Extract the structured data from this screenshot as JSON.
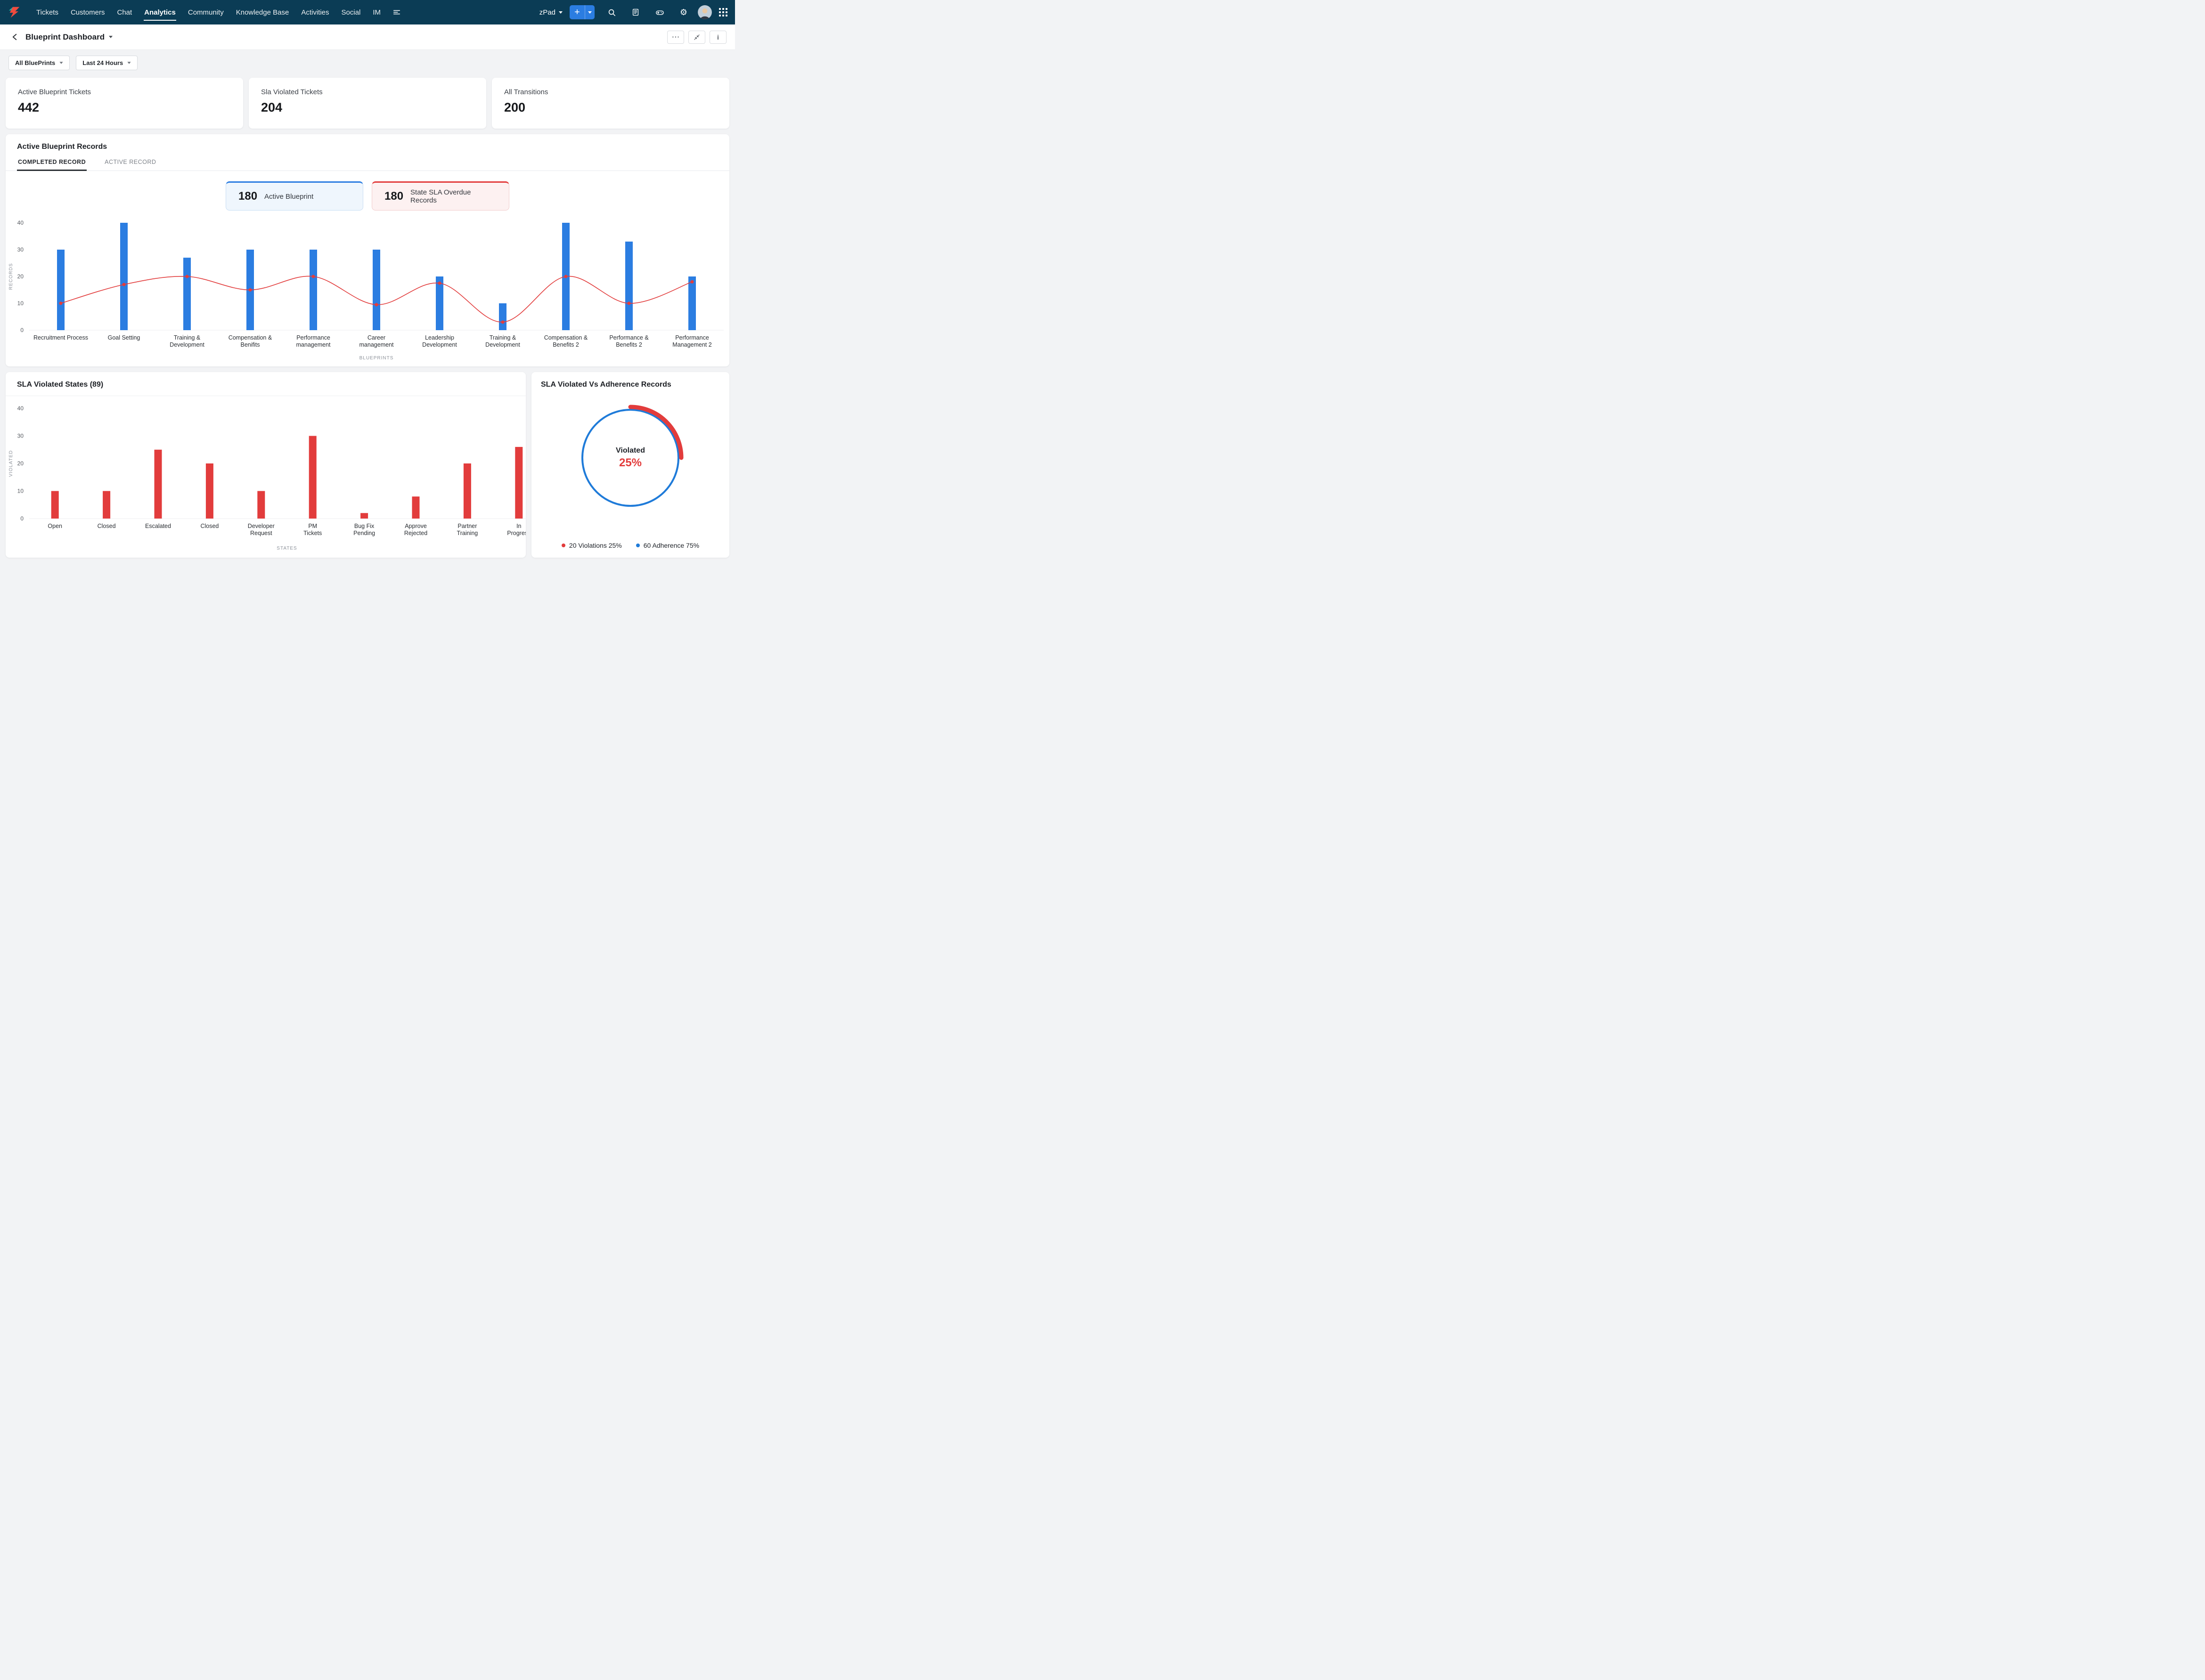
{
  "colors": {
    "navbar_bg": "#0b3c55",
    "accent_blue": "#2b7de1",
    "accent_red": "#e23c3c",
    "donut_blue": "#1f7bd9",
    "page_bg": "#f2f3f5"
  },
  "navbar": {
    "items": [
      "Tickets",
      "Customers",
      "Chat",
      "Analytics",
      "Community",
      "Knowledge Base",
      "Activities",
      "Social",
      "IM"
    ],
    "active_item": "Analytics",
    "workspace": "zPad",
    "add_label": "+",
    "icons": [
      "nav-more-icon",
      "search-icon",
      "reports-icon",
      "games-icon",
      "settings-gear-icon",
      "user-avatar",
      "apps-grid-icon"
    ]
  },
  "header": {
    "title": "Blueprint Dashboard",
    "action_icons": [
      "more-ellipsis-icon",
      "collapse-icon",
      "info-icon"
    ]
  },
  "filters": {
    "blueprint": "All BluePrints",
    "time_range": "Last 24 Hours"
  },
  "kpis": [
    {
      "label": "Active Blueprint Tickets",
      "value": "442"
    },
    {
      "label": "Sla Violated Tickets",
      "value": "204"
    },
    {
      "label": "All Transitions",
      "value": "200"
    }
  ],
  "records_card": {
    "tabs": [
      {
        "label": "COMPLETED RECORD",
        "active": true
      },
      {
        "label": "ACTIVE RECORD",
        "active": false
      }
    ],
    "chips": [
      {
        "value": "180",
        "label": "Active Blueprint",
        "accent": "#2b7de1"
      },
      {
        "value": "180",
        "label": "State SLA Overdue Records",
        "accent": "#e23c3c"
      }
    ]
  },
  "chart_data": [
    {
      "id": "blueprint_records",
      "type": "bar",
      "subtype": "bar-line-combo",
      "title": "Active Blueprint Records",
      "xlabel": "BLUEPRINTS",
      "ylabel": "RECORDS",
      "ylim": [
        0,
        40
      ],
      "yticks": [
        0,
        10,
        20,
        30,
        40
      ],
      "grid": false,
      "categories": [
        [
          "Recruitment Process"
        ],
        [
          "Goal Setting"
        ],
        [
          "Training &",
          "Development"
        ],
        [
          "Compensation &",
          "Benifits"
        ],
        [
          "Performance",
          "management"
        ],
        [
          "Career",
          "management"
        ],
        [
          "Leadership",
          "Development"
        ],
        [
          "Training &",
          "Development"
        ],
        [
          "Compensation &",
          "Benefits 2"
        ],
        [
          "Performance &",
          "Benefits 2"
        ],
        [
          "Performance",
          "Management 2"
        ]
      ],
      "bar_series": {
        "name": "Active Blueprint",
        "color": "#2b7de1",
        "values": [
          30,
          40,
          27,
          30,
          30,
          30,
          20,
          10,
          40,
          33,
          20
        ]
      },
      "line_series": {
        "name": "State SLA Overdue Records",
        "color": "#e23c3c",
        "values": [
          10,
          17,
          20,
          15,
          20,
          9.5,
          17.5,
          3,
          20,
          10,
          18
        ]
      }
    },
    {
      "id": "sla_violated_states",
      "type": "bar",
      "title": "SLA Violated States (89)",
      "xlabel": "STATES",
      "ylabel": "VIOLATED",
      "ylim": [
        0,
        40
      ],
      "yticks": [
        0,
        10,
        20,
        30,
        40
      ],
      "grid": false,
      "categories": [
        [
          "Open"
        ],
        [
          "Closed"
        ],
        [
          "Escalated"
        ],
        [
          "Closed"
        ],
        [
          "Developer",
          "Request"
        ],
        [
          "PM",
          "Tickets"
        ],
        [
          "Bug Fix",
          "Pending"
        ],
        [
          "Approve",
          "Rejected"
        ],
        [
          "Partner",
          "Training"
        ],
        [
          "In",
          "Progress"
        ]
      ],
      "values": [
        10,
        10,
        25,
        20,
        10,
        30,
        2,
        8,
        20,
        26
      ],
      "bar_color": "#e23c3c"
    },
    {
      "id": "sla_violated_vs_adherence",
      "type": "pie",
      "subtype": "donut",
      "title": "SLA Violated Vs Adherence Records",
      "center_label": "Violated",
      "center_value": "25%",
      "legend_position": "bottom",
      "slices": [
        {
          "label": "20 Violations 25%",
          "count": 20,
          "value": 25,
          "color": "#e23c3c"
        },
        {
          "label": "60 Adherence 75%",
          "count": 60,
          "value": 75,
          "color": "#1f7bd9"
        }
      ]
    }
  ]
}
